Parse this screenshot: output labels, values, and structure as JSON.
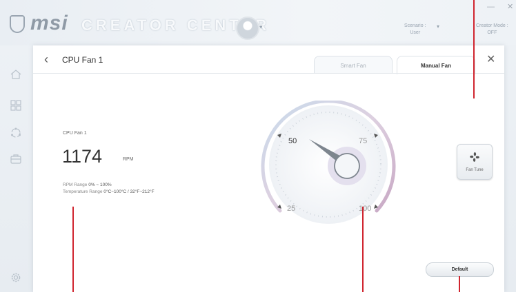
{
  "app": {
    "logo_text": "msi",
    "title": "CREATOR CENTER",
    "scenario_label": "Scenario :",
    "scenario_value": "User",
    "creator_mode_label": "Creator Mode :",
    "creator_mode_value": "OFF",
    "minimize_label": "—",
    "close_label": "✕"
  },
  "sidebar": {
    "items": [
      {
        "icon": "home-icon"
      },
      {
        "icon": "grid-icon"
      },
      {
        "icon": "network-icon"
      },
      {
        "icon": "toolbox-icon"
      }
    ],
    "bottom_icon": "gear-icon"
  },
  "panel": {
    "back_label": "‹",
    "title": "CPU Fan 1",
    "tabs": [
      {
        "label": "Smart Fan",
        "active": false
      },
      {
        "label": "Manual Fan",
        "active": true
      }
    ],
    "close_label": "✕"
  },
  "fan": {
    "name": "CPU Fan 1",
    "rpm": "1174",
    "rpm_unit": "RPM",
    "rpm_range_label": "RPM Range",
    "rpm_range_value": "0% ~ 100%",
    "temp_range_label": "Temperature Range",
    "temp_range_value": "0°C~100°C / 32°F~212°F"
  },
  "gauge": {
    "labels": [
      "50",
      "75",
      "25",
      "100"
    ]
  },
  "buttons": {
    "fan_tune": "Fan Tune",
    "default": "Default"
  },
  "colors": {
    "accent_pink": "#c8a8c4",
    "accent_blue": "#c9dcec",
    "callout_red": "#d0242e"
  }
}
